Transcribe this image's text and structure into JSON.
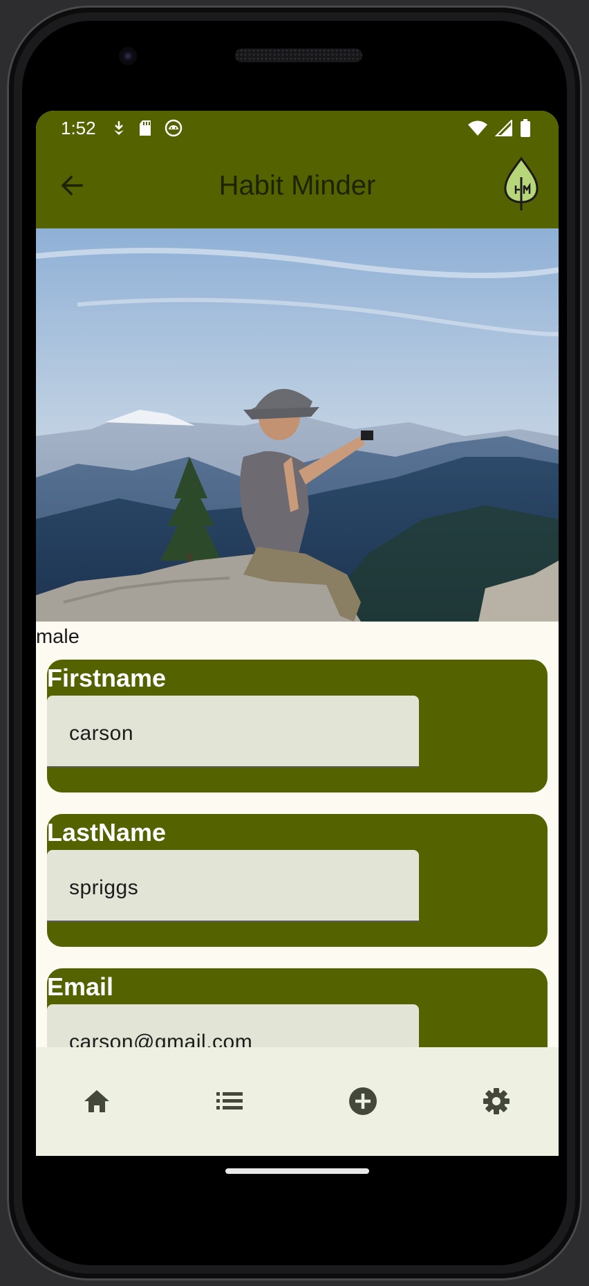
{
  "status_bar": {
    "time": "1:52",
    "icons_left": [
      "download-status-icon",
      "sd-card-icon",
      "android-debug-icon"
    ],
    "icons_right": [
      "wifi-icon",
      "cell-signal-icon",
      "battery-icon"
    ]
  },
  "app_bar": {
    "title": "Habit Minder",
    "back_icon": "arrow-back-icon",
    "logo_icon": "leaf-logo-icon"
  },
  "profile": {
    "image_alt": "person taking a photo on a mountain summit",
    "gender": "male",
    "fields": [
      {
        "label": "Firstname",
        "value": "carson"
      },
      {
        "label": "LastName",
        "value": "spriggs"
      },
      {
        "label": "Email",
        "value": "carson@gmail.com"
      }
    ]
  },
  "bottom_nav": {
    "items": [
      {
        "icon": "home-icon"
      },
      {
        "icon": "list-icon"
      },
      {
        "icon": "add-circle-icon"
      },
      {
        "icon": "settings-icon"
      }
    ]
  },
  "colors": {
    "primary": "#546300",
    "surface": "#fdfaf2",
    "input_fill": "#e2e4d5",
    "nav_background": "#eef0e2"
  }
}
